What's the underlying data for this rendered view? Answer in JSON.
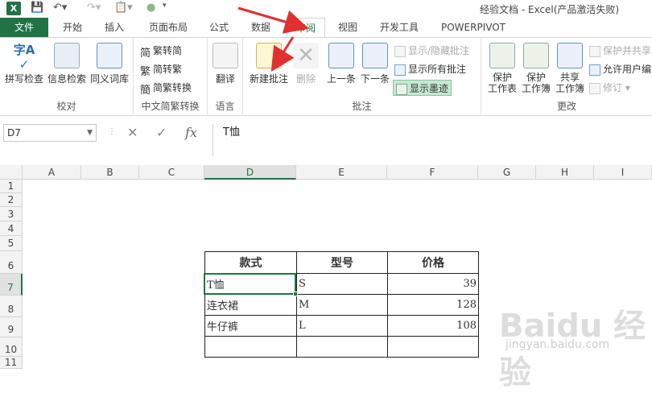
{
  "titlebar": {
    "window_title": "经验文档 - Excel(产品激活失败)",
    "app_icon": "X"
  },
  "tabs": [
    {
      "label": "文件",
      "type": "file"
    },
    {
      "label": "开始"
    },
    {
      "label": "插入"
    },
    {
      "label": "页面布局"
    },
    {
      "label": "公式"
    },
    {
      "label": "数据"
    },
    {
      "label": "审阅",
      "active": true
    },
    {
      "label": "视图"
    },
    {
      "label": "开发工具"
    },
    {
      "label": "POWERPIVOT"
    }
  ],
  "ribbon": {
    "proofing": {
      "label": "校对",
      "buttons": [
        "拼写检查",
        "信息检索",
        "同义词库"
      ]
    },
    "chinese": {
      "label": "中文简繁转换",
      "buttons": [
        "繁转简",
        "简转繁",
        "简繁转换"
      ]
    },
    "language": {
      "label": "语言",
      "buttons": [
        "翻译"
      ]
    },
    "comments": {
      "label": "批注",
      "new": "新建批注",
      "delete": "删除",
      "prev": "上一条",
      "next": "下一条",
      "show_hide": "显示/隐藏批注",
      "show_all": "显示所有批注",
      "show_ink": "显示墨迹"
    },
    "changes": {
      "label": "更改",
      "protect_sheet": [
        "保护",
        "工作表"
      ],
      "protect_book": [
        "保护",
        "工作簿"
      ],
      "share_book": [
        "共享",
        "工作簿"
      ],
      "protect_share": "保护并共享",
      "allow_edit": "允许用户编",
      "track": "修订"
    }
  },
  "formula_bar": {
    "name_box": "D7",
    "formula": "T恤",
    "fx": "fx"
  },
  "columns": [
    "A",
    "B",
    "C",
    "D",
    "E",
    "F",
    "G",
    "H",
    "I"
  ],
  "rows": [
    "1",
    "2",
    "3",
    "4",
    "5",
    "6",
    "7",
    "8",
    "9",
    "10",
    "11"
  ],
  "table": {
    "headers": [
      "款式",
      "型号",
      "价格"
    ],
    "rows": [
      [
        "T恤",
        "S",
        "39"
      ],
      [
        "连衣裙",
        "M",
        "128"
      ],
      [
        "牛仔裤",
        "L",
        "108"
      ],
      [
        "",
        "",
        ""
      ]
    ]
  },
  "watermark": {
    "brand": "Baidu 经验",
    "url": "jingyan.baidu.com"
  },
  "colors": {
    "excel_green": "#217346",
    "arrow_red": "#e03030"
  }
}
